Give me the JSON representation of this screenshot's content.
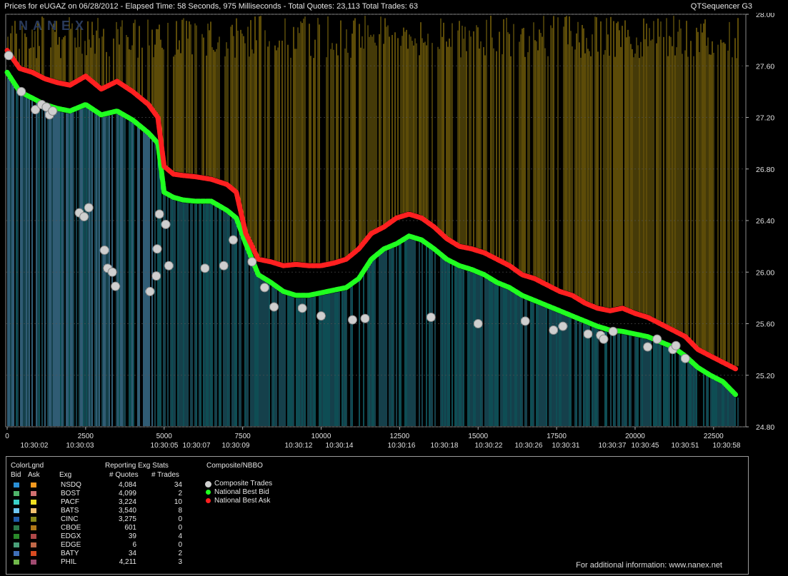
{
  "header": {
    "title": "Prices for  eUGAZ  on  06/28/2012  -  Elapsed Time: 58 Seconds, 975 Milliseconds  -  Total Quotes: 23,113  Total Trades: 63",
    "app": "QTSequencer G3",
    "watermark": "NANEX"
  },
  "chart_data": {
    "type": "line",
    "ylim": [
      24.8,
      28.0
    ],
    "y_ticks": [
      "28.00",
      "27.60",
      "27.20",
      "26.80",
      "26.40",
      "26.00",
      "25.60",
      "25.20",
      "24.80"
    ],
    "xlim": [
      0,
      23300
    ],
    "x_ticks": [
      "0",
      "2500",
      "5000",
      "7500",
      "10000",
      "12500",
      "15000",
      "17500",
      "20000",
      "22500"
    ],
    "time_labels": [
      "10:30:02",
      "10:30:03",
      "10:30:05",
      "10:30:07",
      "10:30:09",
      "10:30:12",
      "10:30:14",
      "10:30:16",
      "10:30:18",
      "10:30:22",
      "10:30:26",
      "10:30:31",
      "10:30:37",
      "10:30:45",
      "10:30:51",
      "10:30:58"
    ],
    "series": [
      {
        "name": "National Best Ask",
        "color": "#ff2020",
        "x": [
          0,
          400,
          800,
          1200,
          1600,
          2000,
          2500,
          3000,
          3500,
          4000,
          4500,
          4800,
          5000,
          5300,
          5600,
          6000,
          6500,
          7000,
          7300,
          7600,
          8000,
          8400,
          8800,
          9200,
          9600,
          10000,
          10400,
          10800,
          11200,
          11600,
          12000,
          12400,
          12800,
          13200,
          13600,
          14000,
          14400,
          14800,
          15200,
          15600,
          16000,
          16400,
          16800,
          17200,
          17600,
          18000,
          18400,
          18800,
          19200,
          19600,
          20000,
          20400,
          20800,
          21200,
          21600,
          22000,
          22400,
          22800,
          23200
        ],
        "values": [
          27.72,
          27.58,
          27.55,
          27.5,
          27.47,
          27.45,
          27.52,
          27.42,
          27.48,
          27.4,
          27.3,
          27.2,
          26.82,
          26.76,
          26.75,
          26.74,
          26.72,
          26.68,
          26.62,
          26.3,
          26.1,
          26.08,
          26.05,
          26.06,
          26.05,
          26.05,
          26.07,
          26.1,
          26.18,
          26.3,
          26.35,
          26.42,
          26.45,
          26.42,
          26.35,
          26.26,
          26.2,
          26.18,
          26.15,
          26.1,
          26.05,
          25.98,
          25.95,
          25.9,
          25.85,
          25.82,
          25.76,
          25.72,
          25.7,
          25.72,
          25.68,
          25.65,
          25.6,
          25.55,
          25.5,
          25.4,
          25.35,
          25.3,
          25.25
        ]
      },
      {
        "name": "National Best Bid",
        "color": "#20ff20",
        "x": [
          0,
          400,
          800,
          1200,
          1600,
          2000,
          2500,
          3000,
          3500,
          4000,
          4500,
          4800,
          5000,
          5300,
          5600,
          6000,
          6500,
          7000,
          7300,
          7600,
          8000,
          8400,
          8800,
          9200,
          9600,
          10000,
          10400,
          10800,
          11200,
          11600,
          12000,
          12400,
          12800,
          13200,
          13600,
          14000,
          14400,
          14800,
          15200,
          15600,
          16000,
          16400,
          16800,
          17200,
          17600,
          18000,
          18400,
          18800,
          19200,
          19600,
          20000,
          20400,
          20800,
          21200,
          21600,
          22000,
          22400,
          22800,
          23200
        ],
        "values": [
          27.55,
          27.4,
          27.35,
          27.3,
          27.27,
          27.25,
          27.3,
          27.22,
          27.25,
          27.18,
          27.08,
          27.0,
          26.62,
          26.58,
          26.56,
          26.55,
          26.55,
          26.48,
          26.42,
          26.22,
          25.98,
          25.92,
          25.85,
          25.82,
          25.82,
          25.84,
          25.86,
          25.88,
          25.95,
          26.1,
          26.18,
          26.22,
          26.28,
          26.25,
          26.18,
          26.1,
          26.05,
          26.02,
          25.98,
          25.92,
          25.88,
          25.82,
          25.78,
          25.74,
          25.7,
          25.66,
          25.62,
          25.58,
          25.55,
          25.54,
          25.52,
          25.5,
          25.46,
          25.42,
          25.35,
          25.26,
          25.2,
          25.15,
          25.05
        ]
      },
      {
        "name": "Composite Trades",
        "color": "#cfcfcf",
        "x": [
          50,
          450,
          900,
          1100,
          1250,
          1350,
          1450,
          2300,
          2450,
          2600,
          3100,
          3200,
          3350,
          3450,
          4550,
          4750,
          4780,
          4850,
          5050,
          5150,
          6300,
          6900,
          7200,
          7800,
          8200,
          8500,
          9400,
          10000,
          11000,
          11400,
          13500,
          15000,
          16500,
          17400,
          17700,
          18500,
          18900,
          19000,
          19300,
          20400,
          20700,
          21200,
          21300,
          21600
        ],
        "values": [
          27.68,
          27.4,
          27.26,
          27.3,
          27.28,
          27.22,
          27.25,
          26.46,
          26.43,
          26.5,
          26.17,
          26.03,
          26.0,
          25.89,
          25.85,
          25.97,
          26.18,
          26.45,
          26.37,
          26.05,
          26.03,
          26.05,
          26.25,
          26.08,
          25.88,
          25.73,
          25.72,
          25.66,
          25.63,
          25.64,
          25.65,
          25.6,
          25.62,
          25.55,
          25.58,
          25.52,
          25.51,
          25.48,
          25.54,
          25.42,
          25.48,
          25.4,
          25.43,
          25.33
        ]
      }
    ]
  },
  "legend": {
    "col_headers": {
      "colorlgnd": "ColorLgnd",
      "bid": "Bid",
      "ask": "Ask",
      "exg": "Exg",
      "stats": "Reporting Exg Stats",
      "quotes": "# Quotes",
      "trades": "# Trades",
      "composite": "Composite/NBBO"
    },
    "rows": [
      {
        "exg": "NSDQ",
        "quotes": "4,084",
        "trades": "34",
        "bid_color": "#2a8fd6",
        "ask_color": "#f59a1f"
      },
      {
        "exg": "BOST",
        "quotes": "4,099",
        "trades": "2",
        "bid_color": "#4fb56a",
        "ask_color": "#d07070"
      },
      {
        "exg": "PACF",
        "quotes": "3,224",
        "trades": "10",
        "bid_color": "#3ad0c8",
        "ask_color": "#f0e020"
      },
      {
        "exg": "BATS",
        "quotes": "3,540",
        "trades": "8",
        "bid_color": "#6ec6f2",
        "ask_color": "#f2c070"
      },
      {
        "exg": "CINC",
        "quotes": "3,275",
        "trades": "0",
        "bid_color": "#1e5aa8",
        "ask_color": "#8a8a18"
      },
      {
        "exg": "CBOE",
        "quotes": "601",
        "trades": "0",
        "bid_color": "#2b7a4a",
        "ask_color": "#b07818"
      },
      {
        "exg": "EDGX",
        "quotes": "39",
        "trades": "4",
        "bid_color": "#2a8a2a",
        "ask_color": "#b04848"
      },
      {
        "exg": "EDGE",
        "quotes": "6",
        "trades": "0",
        "bid_color": "#4aa07a",
        "ask_color": "#c06848"
      },
      {
        "exg": "BATY",
        "quotes": "34",
        "trades": "2",
        "bid_color": "#3f6fb8",
        "ask_color": "#d84a20"
      },
      {
        "exg": "PHIL",
        "quotes": "4,211",
        "trades": "3",
        "bid_color": "#70b84a",
        "ask_color": "#a04a70"
      }
    ],
    "nbbo": [
      {
        "label": "Composite Trades",
        "color": "#cfcfcf"
      },
      {
        "label": "National Best Bid",
        "color": "#20ff20"
      },
      {
        "label": "National Best Ask",
        "color": "#ff2020"
      }
    ],
    "footer": "For additional information: www.nanex.net"
  }
}
